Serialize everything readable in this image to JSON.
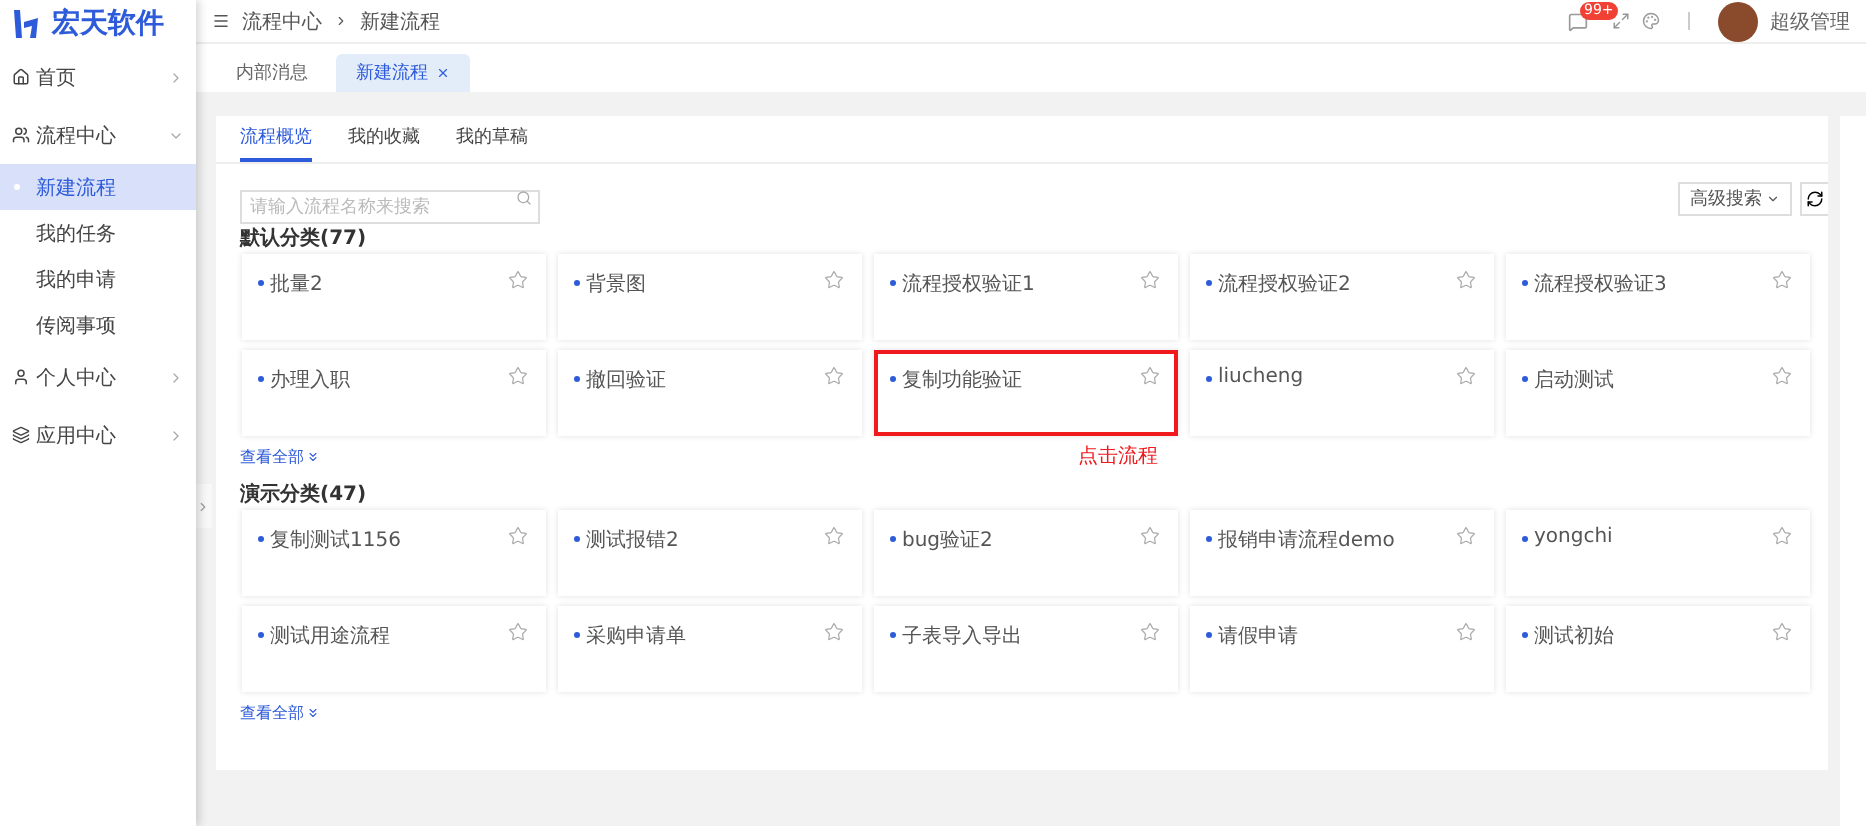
{
  "logo": {
    "text": "宏天软件"
  },
  "sidebar": {
    "items": [
      {
        "label": "首页",
        "expanded": false
      },
      {
        "label": "流程中心",
        "expanded": true,
        "children": [
          {
            "label": "新建流程",
            "selected": true
          },
          {
            "label": "我的任务",
            "selected": false
          },
          {
            "label": "我的申请",
            "selected": false
          },
          {
            "label": "传阅事项",
            "selected": false
          }
        ]
      },
      {
        "label": "个人中心",
        "expanded": false
      },
      {
        "label": "应用中心",
        "expanded": false
      }
    ]
  },
  "breadcrumb": [
    "流程中心",
    "新建流程"
  ],
  "header": {
    "badge": "99+",
    "user": "超级管理"
  },
  "page_tabs": [
    {
      "label": "内部消息",
      "selected": false
    },
    {
      "label": "新建流程",
      "selected": true
    }
  ],
  "inner_tabs": [
    {
      "label": "流程概览",
      "selected": true
    },
    {
      "label": "我的收藏",
      "selected": false
    },
    {
      "label": "我的草稿",
      "selected": false
    }
  ],
  "search": {
    "placeholder": "请输入流程名称来搜索"
  },
  "advanced_search": "高级搜索",
  "groups": [
    {
      "title": "默认分类(77)",
      "more": "查看全部",
      "items": [
        {
          "name": "批量2",
          "highlighted": false
        },
        {
          "name": "背景图",
          "highlighted": false
        },
        {
          "name": "流程授权验证1",
          "highlighted": false
        },
        {
          "name": "流程授权验证2",
          "highlighted": false
        },
        {
          "name": "流程授权验证3",
          "highlighted": false
        },
        {
          "name": "办理入职",
          "highlighted": false
        },
        {
          "name": "撤回验证",
          "highlighted": false
        },
        {
          "name": "复制功能验证",
          "highlighted": true,
          "annotation": "点击流程"
        },
        {
          "name": "liucheng",
          "highlighted": false
        },
        {
          "name": "启动测试",
          "highlighted": false
        }
      ]
    },
    {
      "title": "演示分类(47)",
      "more": "查看全部",
      "items": [
        {
          "name": "复制测试1156",
          "highlighted": false
        },
        {
          "name": "测试报错2",
          "highlighted": false
        },
        {
          "name": "bug验证2",
          "highlighted": false
        },
        {
          "name": "报销申请流程demo",
          "highlighted": false
        },
        {
          "name": "yongchi",
          "highlighted": false
        },
        {
          "name": "测试用途流程",
          "highlighted": false
        },
        {
          "name": "采购申请单",
          "highlighted": false
        },
        {
          "name": "子表导入导出",
          "highlighted": false
        },
        {
          "name": "请假申请",
          "highlighted": false
        },
        {
          "name": "测试初始",
          "highlighted": false
        }
      ]
    }
  ]
}
